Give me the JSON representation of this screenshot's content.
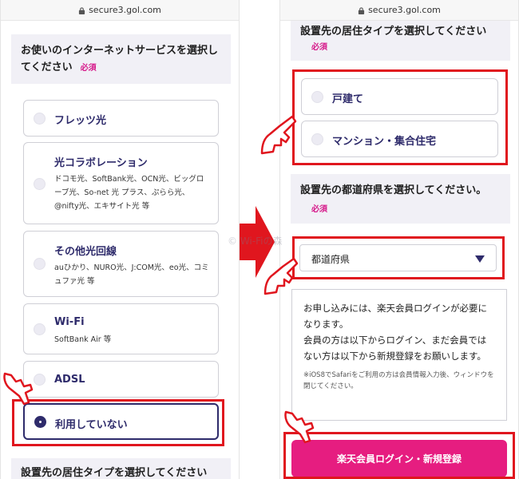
{
  "url": "secure3.gol.com",
  "left_screen": {
    "service_question": "お使いのインターネットサービスを選択し\nてください",
    "required": "必須",
    "options": [
      {
        "title": "フレッツ光",
        "desc": "",
        "selected": false
      },
      {
        "title": "光コラボレーション",
        "desc": "ドコモ光、SoftBank光、OCN光、ビッグローブ光、So-net 光 プラス、ぷらら光、@nifty光、エキサイト光 等",
        "selected": false
      },
      {
        "title": "その他光回線",
        "desc": "auひかり、NURO光、J:COM光、eo光、コミュファ光 等",
        "selected": false
      },
      {
        "title": "Wi-Fi",
        "desc": "SoftBank Air 等",
        "selected": false
      },
      {
        "title": "ADSL",
        "desc": "",
        "selected": false
      },
      {
        "title": "利用していない",
        "desc": "",
        "selected": true
      }
    ],
    "next_question": "設置先の居住タイプを選択してください"
  },
  "right_screen": {
    "residence_question": "設置先の居住タイプを選択してください",
    "required": "必須",
    "residence_options": [
      {
        "title": "戸建て",
        "selected": false
      },
      {
        "title": "マンション・集合住宅",
        "selected": false
      }
    ],
    "prefecture_question": "設置先の都道府県を選択してください。",
    "prefecture_select": {
      "value": "都道府県"
    },
    "notice_main": "お申し込みには、楽天会員ログインが必要になります。\n会員の方は以下からログイン、まだ会員ではない方は以下から新規登録をお願いします。",
    "notice_note": "※iOS8でSafariをご利用の方は会員情報入力後、ウィンドウを閉じてください。",
    "cta_label": "楽天会員ログイン・新規登録"
  },
  "watermark": "© Wi-Fiの森",
  "colors": {
    "accent_navy": "#2e2b6b",
    "required_pink": "#d6198a",
    "cta_pink": "#e61d80",
    "highlight_red": "#e0161e",
    "question_bg": "#f1f0f6"
  }
}
